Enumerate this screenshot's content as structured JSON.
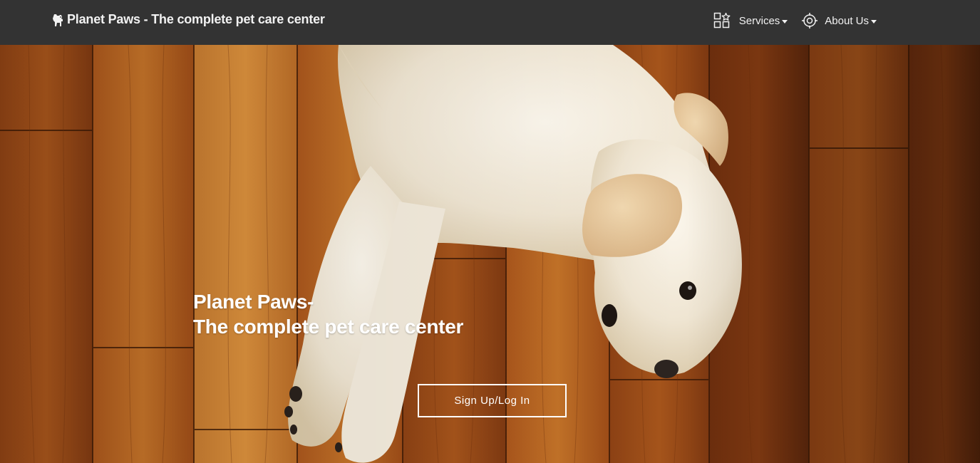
{
  "navbar": {
    "brand": {
      "icon": "dog-icon",
      "label": "Planet Paws - The complete pet care center"
    },
    "menu": [
      {
        "label": "Services",
        "icon": "services-grid-icon"
      },
      {
        "label": "About Us",
        "icon": "target-icon"
      }
    ]
  },
  "hero": {
    "title_line1": "Planet Paws-",
    "title_line2": "The complete pet care center",
    "cta_label": "Sign Up/Log In",
    "background": "wooden-floor-with-puppy"
  },
  "colors": {
    "navbar_bg": "#333333",
    "nav_text": "#f2f2f2",
    "hero_text": "#ffffff"
  }
}
